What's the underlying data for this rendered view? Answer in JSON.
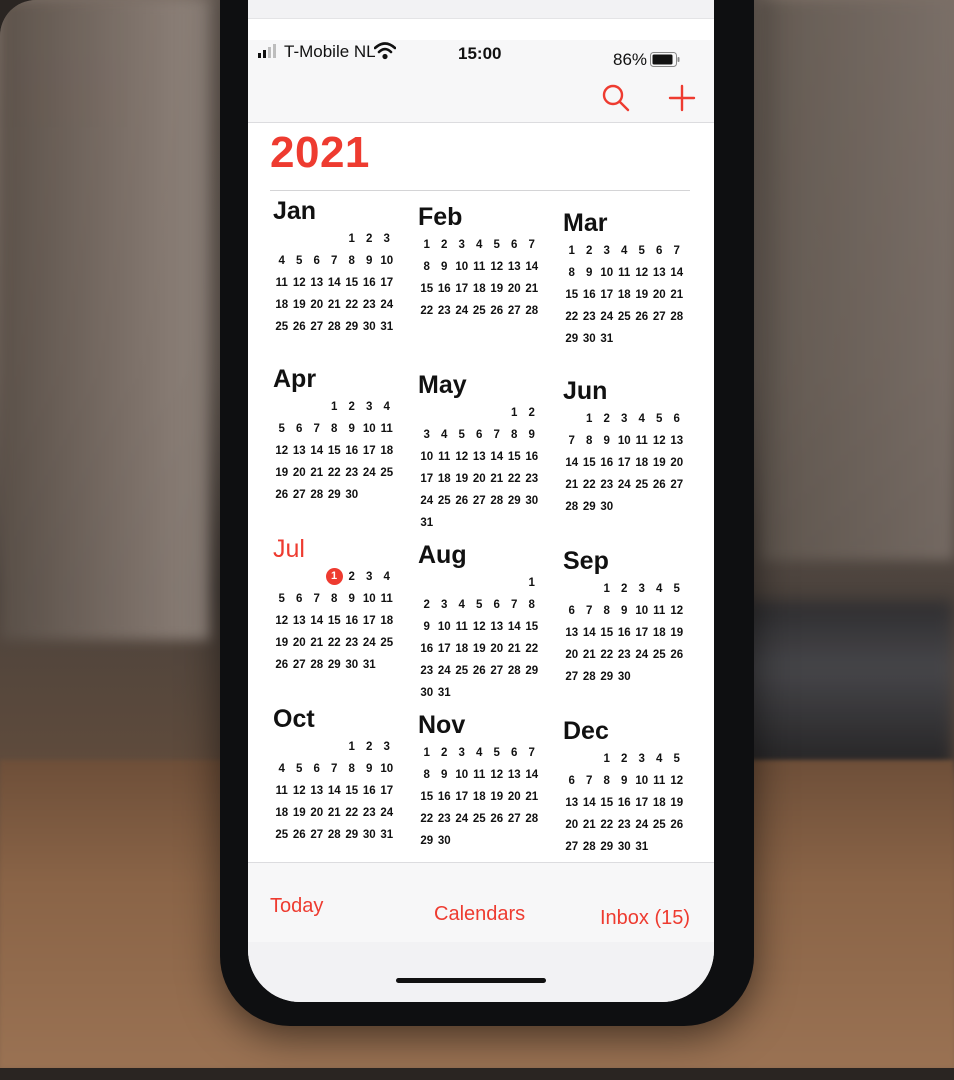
{
  "status": {
    "carrier": "T-Mobile NL",
    "time": "15:00",
    "battery": "86%"
  },
  "nav": {
    "search_icon": "magnifier",
    "add_icon": "plus"
  },
  "colors": {
    "accent": "#ee3b30",
    "banner": "#f27d1b"
  },
  "calendar": {
    "year": "2021",
    "months": [
      {
        "name": "Jan",
        "offset": 4,
        "days": 31
      },
      {
        "name": "Feb",
        "offset": 0,
        "days": 28
      },
      {
        "name": "Mar",
        "offset": 0,
        "days": 31
      },
      {
        "name": "Apr",
        "offset": 3,
        "days": 30
      },
      {
        "name": "May",
        "offset": 5,
        "days": 31
      },
      {
        "name": "Jun",
        "offset": 1,
        "days": 30
      },
      {
        "name": "Jul",
        "offset": 3,
        "days": 31,
        "current": true,
        "today": 1
      },
      {
        "name": "Aug",
        "offset": 6,
        "days": 31
      },
      {
        "name": "Sep",
        "offset": 2,
        "days": 30
      },
      {
        "name": "Oct",
        "offset": 4,
        "days": 31
      },
      {
        "name": "Nov",
        "offset": 0,
        "days": 30
      },
      {
        "name": "Dec",
        "offset": 2,
        "days": 31
      }
    ]
  },
  "toolbar": {
    "today": "Today",
    "calendars": "Calendars",
    "inbox": "Inbox (15)"
  }
}
